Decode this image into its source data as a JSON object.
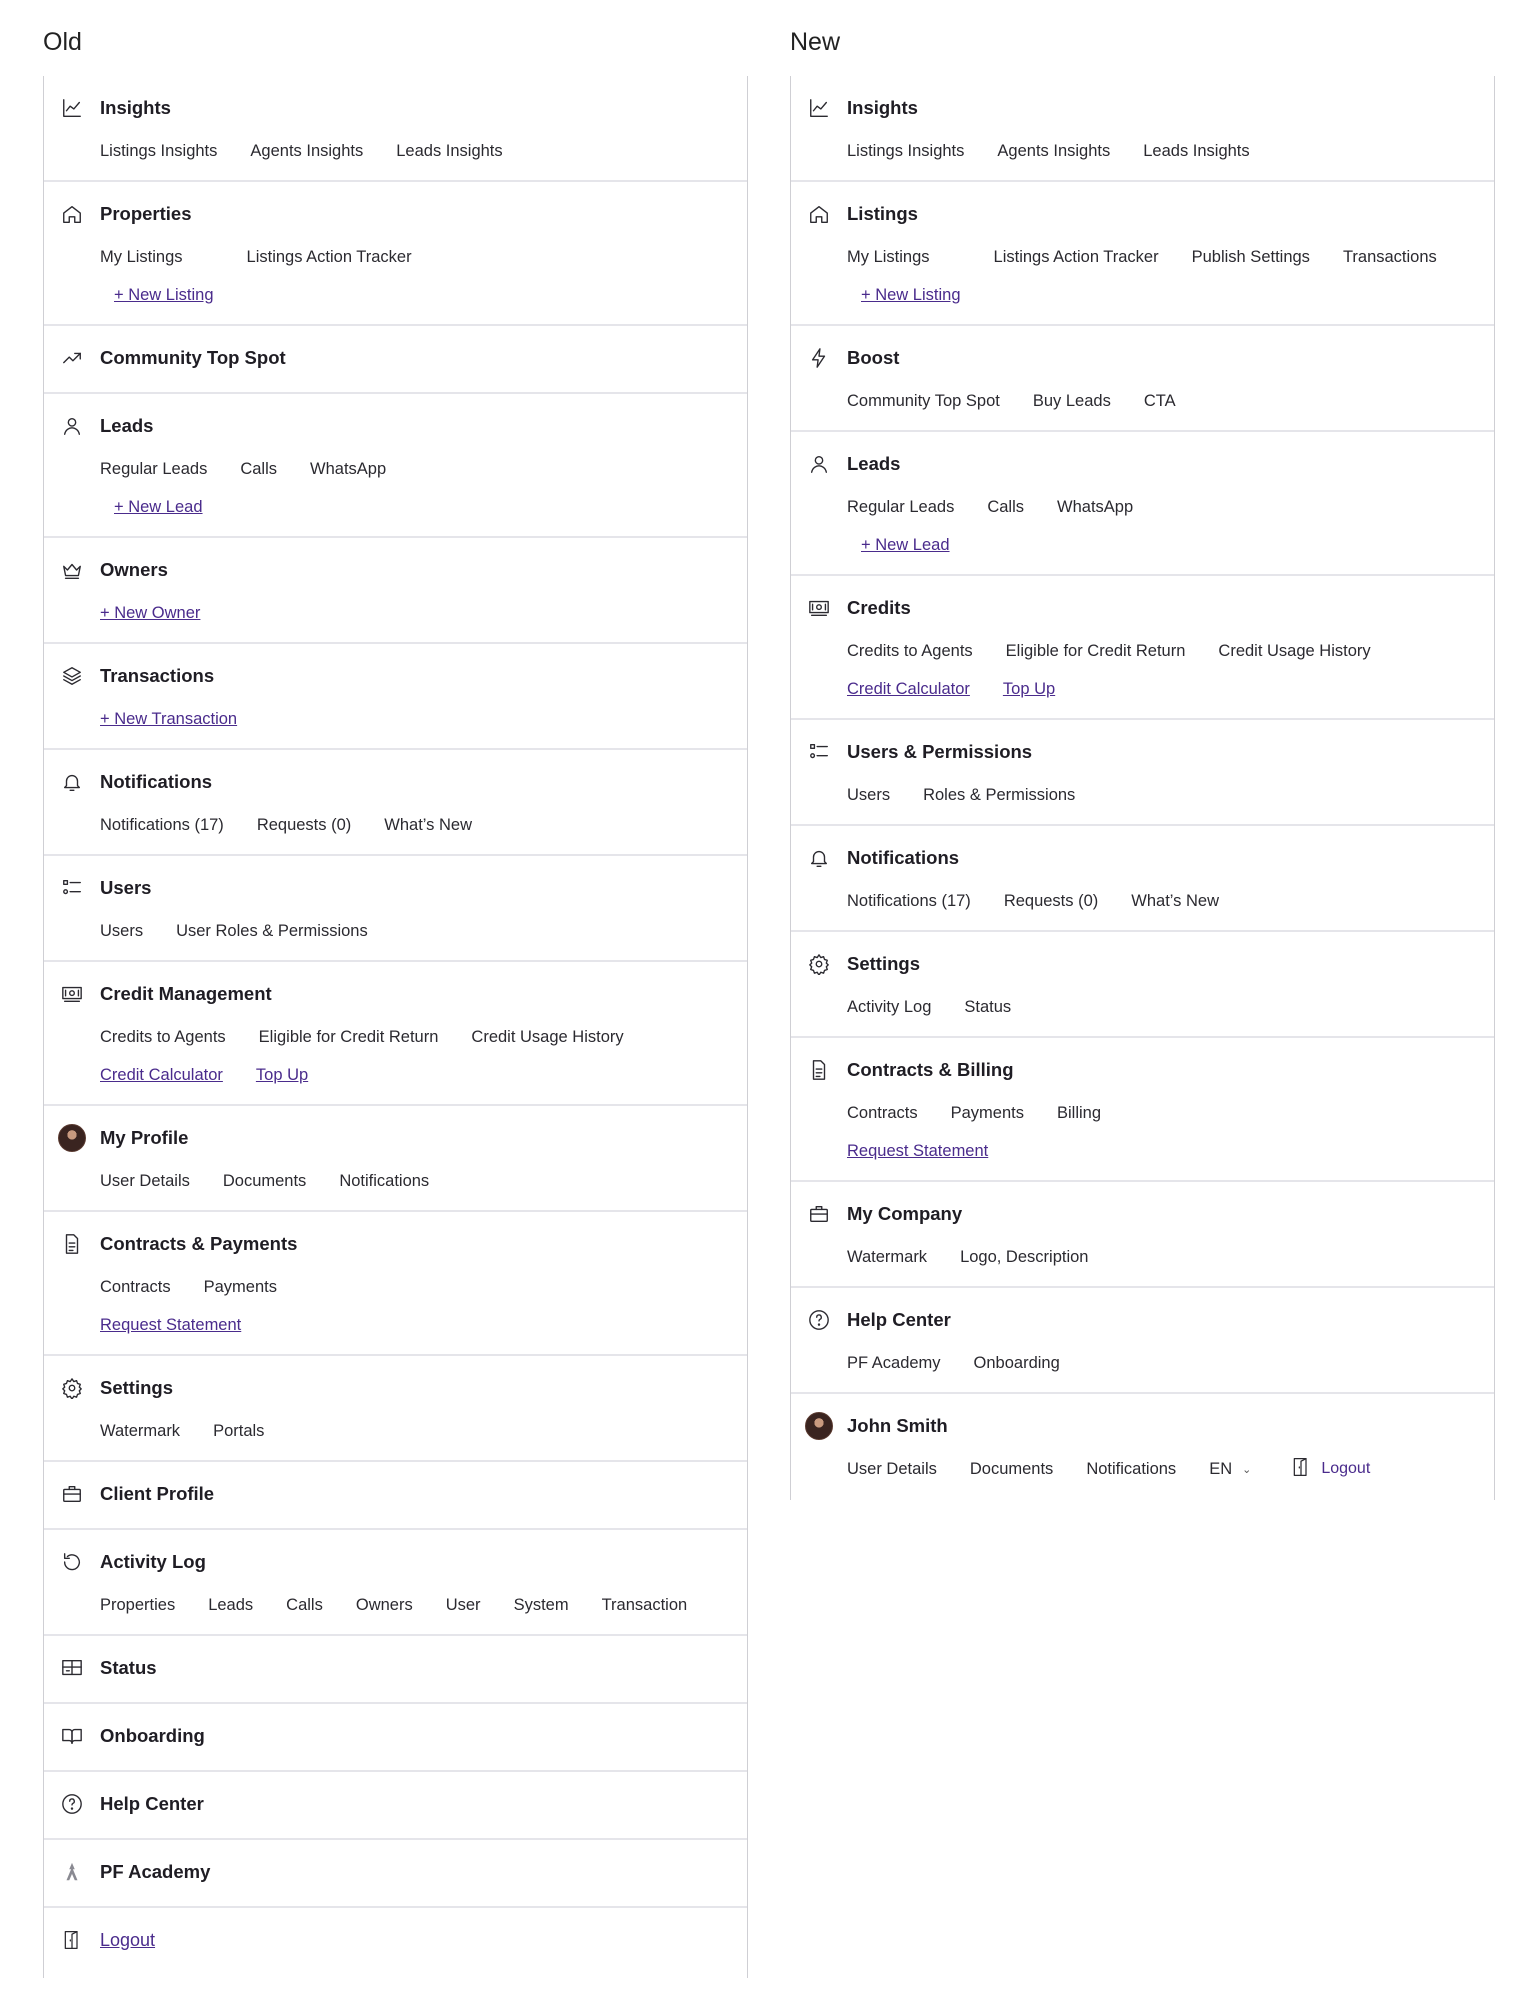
{
  "old": {
    "title": "Old",
    "sections": [
      {
        "icon": "chart-line-icon",
        "name": "insights",
        "title": "Insights",
        "links": [
          "Listings Insights",
          "Agents Insights",
          "Leads Insights"
        ],
        "actions": []
      },
      {
        "icon": "home-icon",
        "name": "properties",
        "title": "Properties",
        "links": [
          "My Listings",
          "Listings Action Tracker"
        ],
        "actions": [
          "+ New Listing"
        ]
      },
      {
        "icon": "trending-up-icon",
        "name": "community-top-spot",
        "title": "Community Top Spot",
        "links": [],
        "actions": []
      },
      {
        "icon": "user-icon",
        "name": "leads",
        "title": "Leads",
        "links": [
          "Regular Leads",
          "Calls",
          "WhatsApp"
        ],
        "actions": [
          "+ New Lead"
        ]
      },
      {
        "icon": "crown-icon",
        "name": "owners",
        "title": "Owners",
        "links": [],
        "actions": [
          "+ New Owner"
        ]
      },
      {
        "icon": "layers-icon",
        "name": "transactions",
        "title": "Transactions",
        "links": [],
        "actions": [
          "+ New Transaction"
        ]
      },
      {
        "icon": "bell-icon",
        "name": "notifications",
        "title": "Notifications",
        "links": [
          "Notifications (17)",
          "Requests (0)",
          "What’s New"
        ],
        "actions": []
      },
      {
        "icon": "list-icon",
        "name": "users",
        "title": "Users",
        "links": [
          "Users",
          "User Roles & Permissions"
        ],
        "actions": []
      },
      {
        "icon": "money-icon",
        "name": "credit-management",
        "title": "Credit Management",
        "links": [
          "Credits to Agents",
          "Eligible for Credit Return",
          "Credit Usage History"
        ],
        "actions": [
          "Credit Calculator",
          "Top Up"
        ]
      },
      {
        "icon": "avatar-icon",
        "name": "my-profile",
        "title": "My Profile",
        "links": [
          "User Details",
          "Documents",
          "Notifications"
        ],
        "actions": []
      },
      {
        "icon": "document-icon",
        "name": "contracts-payments",
        "title": "Contracts & Payments",
        "links": [
          "Contracts",
          "Payments"
        ],
        "actions": [
          "Request Statement"
        ]
      },
      {
        "icon": "gear-icon",
        "name": "settings",
        "title": "Settings",
        "links": [
          "Watermark",
          "Portals"
        ],
        "actions": []
      },
      {
        "icon": "briefcase-icon",
        "name": "client-profile",
        "title": "Client Profile",
        "links": [],
        "actions": []
      },
      {
        "icon": "history-icon",
        "name": "activity-log",
        "title": "Activity Log",
        "links": [
          "Properties",
          "Leads",
          "Calls",
          "Owners",
          "User",
          "System",
          "Transaction"
        ],
        "actions": []
      },
      {
        "icon": "status-icon",
        "name": "status",
        "title": "Status",
        "links": [],
        "actions": []
      },
      {
        "icon": "book-icon",
        "name": "onboarding",
        "title": "Onboarding",
        "links": [],
        "actions": []
      },
      {
        "icon": "help-icon",
        "name": "help-center",
        "title": "Help Center",
        "links": [],
        "actions": []
      },
      {
        "icon": "academy-icon",
        "name": "pf-academy",
        "title": "PF Academy",
        "links": [],
        "actions": []
      }
    ],
    "logout": "Logout"
  },
  "new": {
    "title": "New",
    "sections": [
      {
        "icon": "chart-line-icon",
        "name": "insights",
        "title": "Insights",
        "links": [
          "Listings Insights",
          "Agents Insights",
          "Leads Insights"
        ],
        "actions": []
      },
      {
        "icon": "home-icon",
        "name": "listings",
        "title": "Listings",
        "links": [
          "My Listings",
          "Listings Action Tracker",
          "Publish Settings",
          "Transactions"
        ],
        "actions": [
          "+ New Listing"
        ]
      },
      {
        "icon": "bolt-icon",
        "name": "boost",
        "title": "Boost",
        "links": [
          "Community Top Spot",
          "Buy Leads",
          "CTA"
        ],
        "actions": []
      },
      {
        "icon": "user-icon",
        "name": "leads",
        "title": "Leads",
        "links": [
          "Regular Leads",
          "Calls",
          "WhatsApp"
        ],
        "actions": [
          "+ New Lead"
        ]
      },
      {
        "icon": "money-icon",
        "name": "credits",
        "title": "Credits",
        "links": [
          "Credits to Agents",
          "Eligible for Credit Return",
          "Credit Usage History"
        ],
        "actions": [
          "Credit Calculator",
          "Top Up"
        ]
      },
      {
        "icon": "list-icon",
        "name": "users-permissions",
        "title": "Users & Permissions",
        "links": [
          "Users",
          "Roles & Permissions"
        ],
        "actions": []
      },
      {
        "icon": "bell-icon",
        "name": "notifications",
        "title": "Notifications",
        "links": [
          "Notifications (17)",
          "Requests (0)",
          "What’s New"
        ],
        "actions": []
      },
      {
        "icon": "gear-icon",
        "name": "settings",
        "title": "Settings",
        "links": [
          "Activity Log",
          "Status"
        ],
        "actions": []
      },
      {
        "icon": "document-icon",
        "name": "contracts-billing",
        "title": "Contracts & Billing",
        "links": [
          "Contracts",
          "Payments",
          "Billing"
        ],
        "actions": [
          "Request Statement"
        ]
      },
      {
        "icon": "briefcase-icon",
        "name": "my-company",
        "title": "My Company",
        "links": [
          "Watermark",
          "Logo, Description"
        ],
        "actions": []
      },
      {
        "icon": "help-icon",
        "name": "help-center",
        "title": "Help Center",
        "links": [
          "PF Academy",
          "Onboarding"
        ],
        "actions": []
      },
      {
        "icon": "avatar-icon",
        "name": "john-smith",
        "title": "John Smith",
        "links": [
          "User Details",
          "Documents",
          "Notifications"
        ],
        "actions": [],
        "language": "EN",
        "logout": "Logout"
      }
    ]
  },
  "colors": {
    "link": "#4a2b8c",
    "text": "#1f1d24",
    "divider": "#e5e5ea"
  }
}
